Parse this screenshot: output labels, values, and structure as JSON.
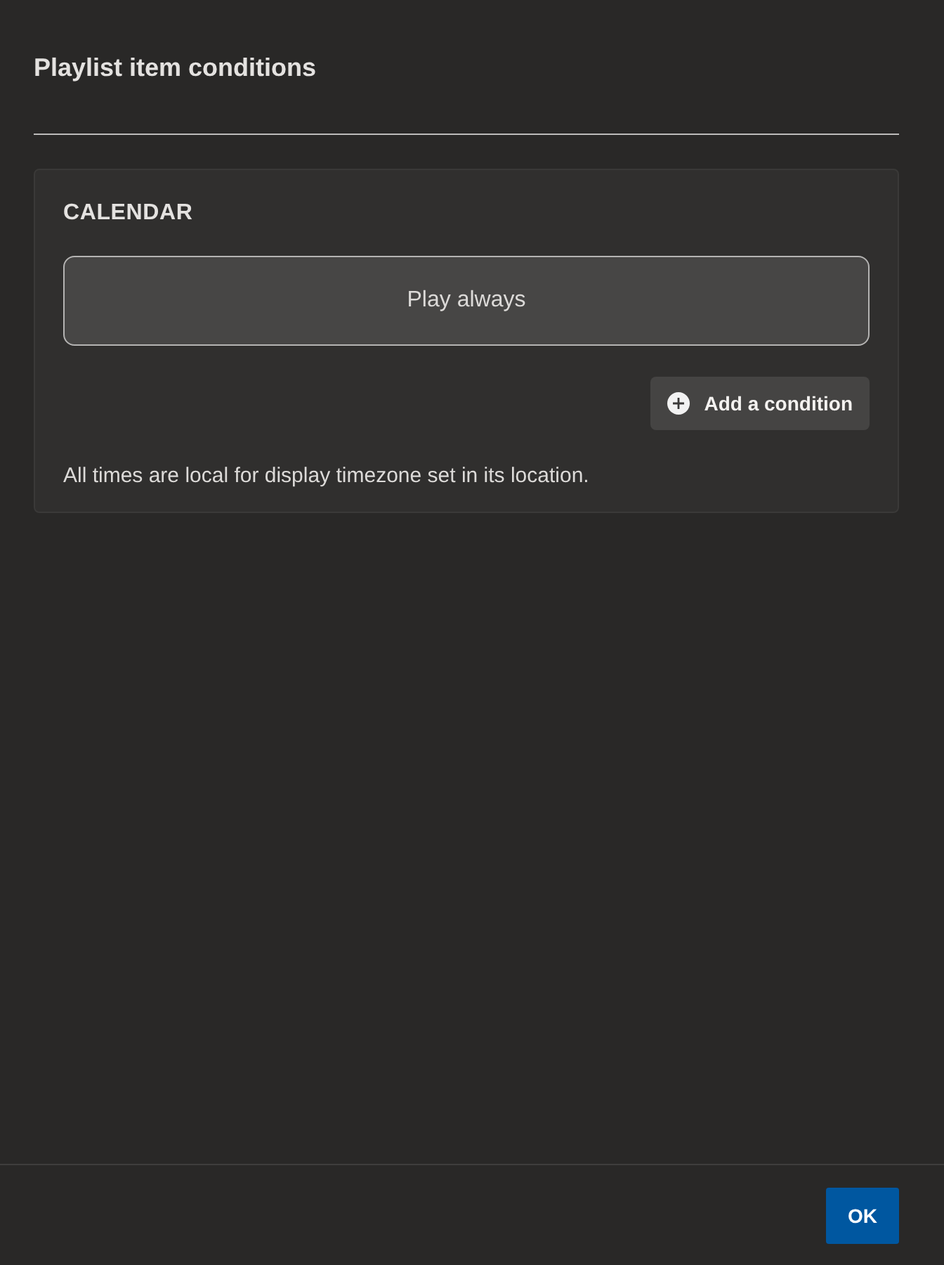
{
  "dialog": {
    "title": "Playlist item conditions"
  },
  "section": {
    "heading": "CALENDAR",
    "conditions": [
      {
        "kind": "summary",
        "text": "Play always"
      }
    ],
    "add_button": {
      "label": "Add a condition"
    },
    "note": "All times are local for display timezone set in its location."
  },
  "footer": {
    "buttons": [
      {
        "kind": "primary",
        "label": "OK"
      }
    ]
  }
}
